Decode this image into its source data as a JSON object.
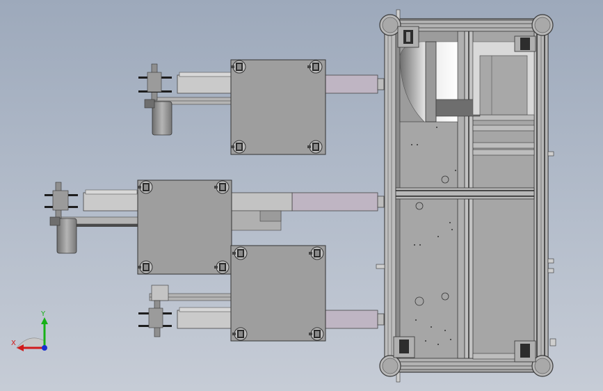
{
  "viewport": {
    "background_top": "#9da9bb",
    "background_bottom": "#c6ccd6"
  },
  "colors": {
    "plate_fill": "#9e9e9e",
    "frame_fill": "#a7a7a7",
    "profile_dark": "#5a5a5a",
    "arm_fill": "#c9c9c9",
    "slide_fill": "#bfb6c2",
    "motor_fill": "#8c8c8c",
    "x_axis": "#d11a1a",
    "y_axis": "#17b117",
    "z_axis": "#1a2fd1"
  },
  "triad": {
    "x_label": "X",
    "y_label": "Y"
  },
  "icons": {
    "caster": "caster-wheel-icon",
    "coordinate_triad": "coordinate-triad-icon"
  }
}
